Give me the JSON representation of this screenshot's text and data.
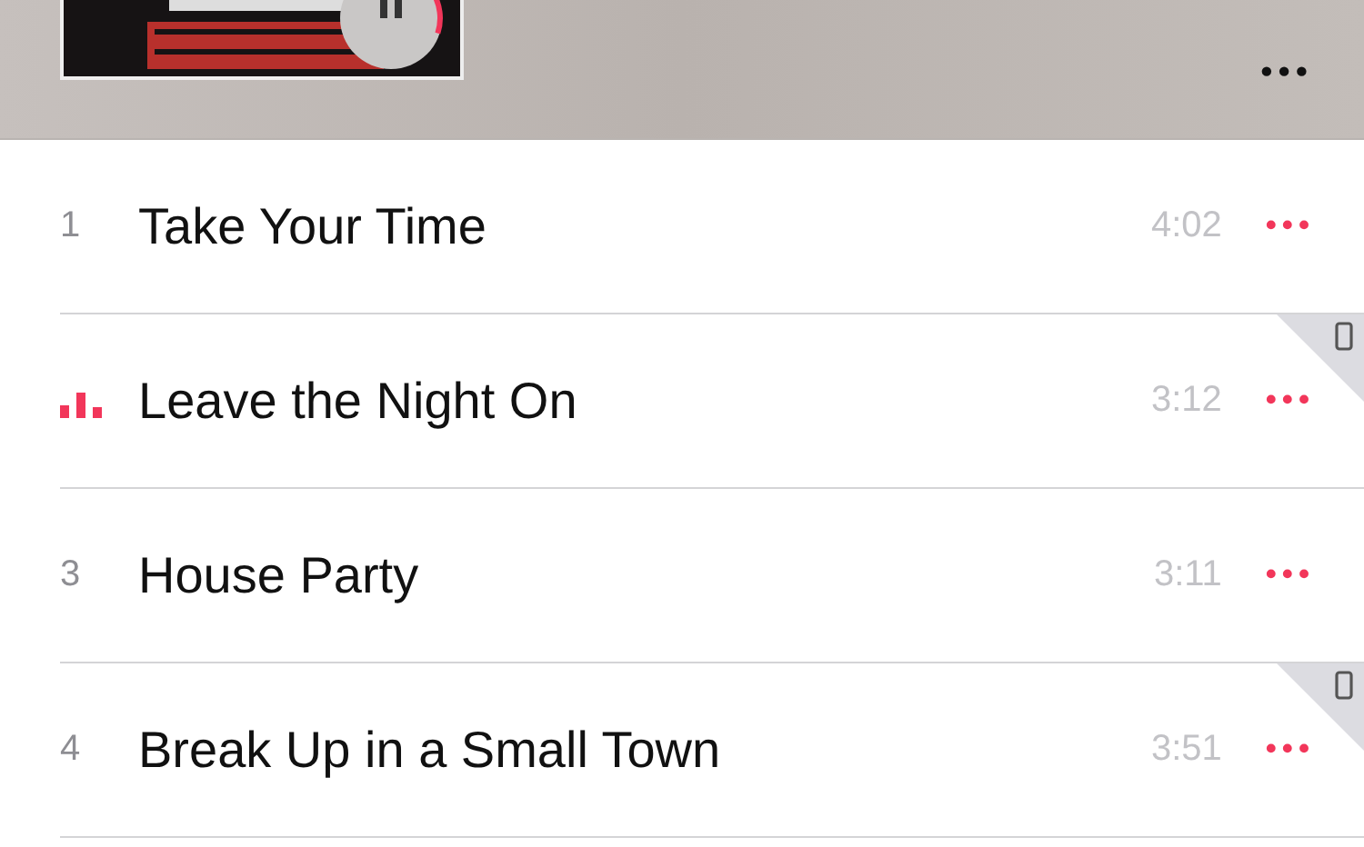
{
  "header": {
    "more": "•••"
  },
  "tracks": [
    {
      "number": "1",
      "title": "Take Your Time",
      "duration": "4:02",
      "playing": false,
      "on_device": false,
      "more": "•••"
    },
    {
      "title": "Leave the Night On",
      "duration": "3:12",
      "playing": true,
      "on_device": true,
      "more": "•••"
    },
    {
      "number": "3",
      "title": "House Party",
      "duration": "3:11",
      "playing": false,
      "on_device": false,
      "more": "•••"
    },
    {
      "number": "4",
      "title": "Break Up in a Small Town",
      "duration": "3:51",
      "playing": false,
      "on_device": true,
      "more": "•••"
    }
  ]
}
